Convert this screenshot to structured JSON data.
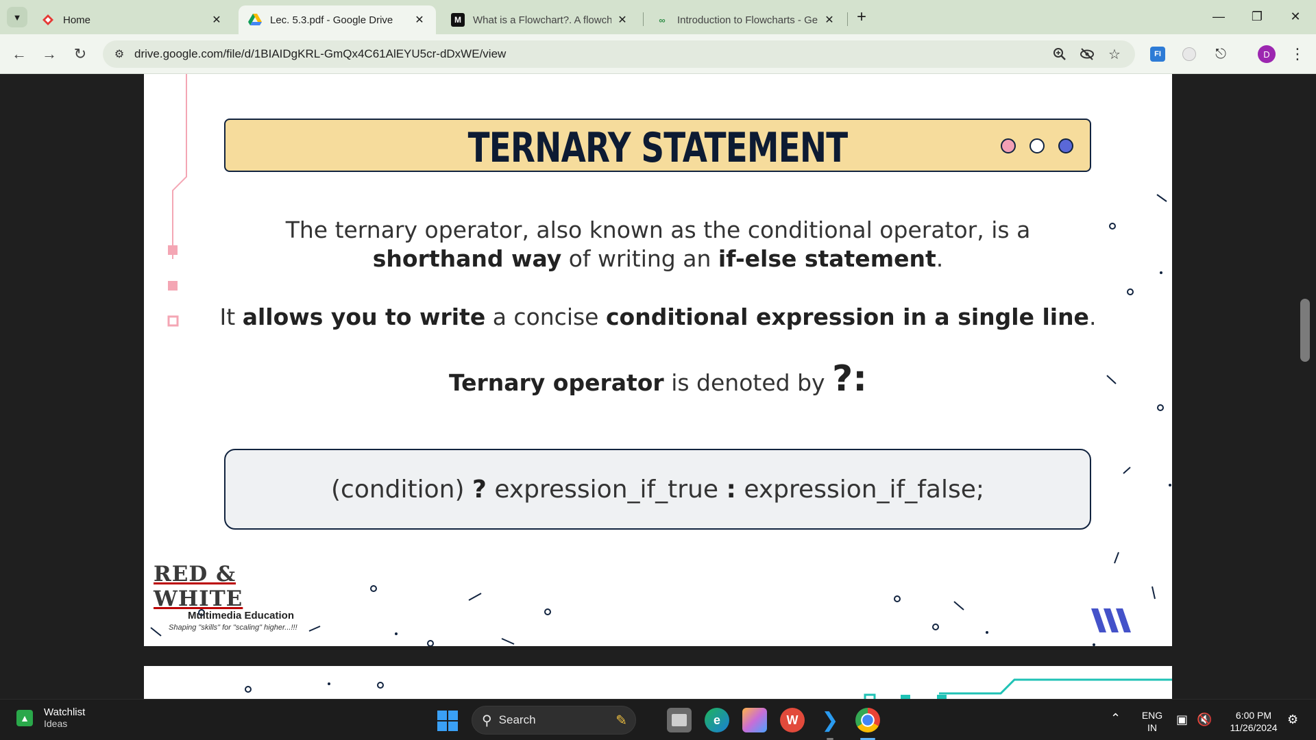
{
  "browser": {
    "tabs": [
      {
        "title": "Home",
        "favicon": "red-diamond-icon",
        "active": false
      },
      {
        "title": "Lec. 5.3.pdf - Google Drive",
        "favicon": "google-drive-icon",
        "active": true
      },
      {
        "title": "What is a Flowchart?. A flowcha",
        "favicon": "medium-icon",
        "active": false
      },
      {
        "title": "Introduction to Flowcharts - Ge",
        "favicon": "geeksforgeeks-icon",
        "active": false
      }
    ],
    "url": "drive.google.com/file/d/1BIAIDgKRL-GmQx4C61AlEYU5cr-dDxWE/view",
    "profile_initial": "D",
    "medium_favicon_text": "M",
    "ext_text": "FI"
  },
  "slide": {
    "title": "TERNARY STATEMENT",
    "dot_colors": [
      "#f2a0b5",
      "#ffffff",
      "#5a68d8"
    ],
    "para1_line1": "The ternary operator, also known as the conditional operator, is a",
    "para1_b1": "shorthand way",
    "para1_t1": " of writing an ",
    "para1_b2": "if-else statement",
    "para1_t2": ".",
    "para2_t0": "It ",
    "para2_b1": "allows you to write",
    "para2_t1": " a concise ",
    "para2_b2": "conditional expression in a single line",
    "para2_t2": ".",
    "para3_b1": "Ternary operator",
    "para3_t1": " is denoted by ",
    "para3_symbol": "?:",
    "code_t0": "(condition) ",
    "code_q": "?",
    "code_t1": " expression_if_true ",
    "code_colon": ":",
    "code_t2": " expression_if_false;",
    "logo_name": "RED & WHITE",
    "logo_sub": "Multimedia Education",
    "logo_tag": "Shaping \"skills\" for \"scaling\" higher...!!!",
    "accent_pink": "#f4a6b4",
    "accent_navy": "#11233f",
    "accent_teal": "#1fc2b5"
  },
  "taskbar": {
    "widget_title": "Watchlist",
    "widget_subtitle": "Ideas",
    "search_placeholder": "Search",
    "lang_line1": "ENG",
    "lang_line2": "IN",
    "time": "6:00 PM",
    "date": "11/26/2024"
  }
}
